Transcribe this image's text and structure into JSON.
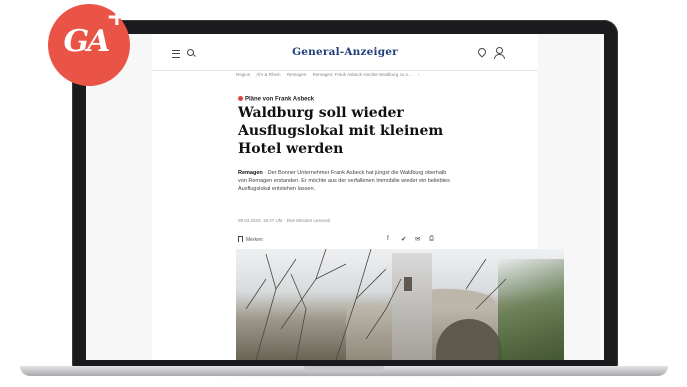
{
  "brand": {
    "logo_text": "GA",
    "logo_plus": "+",
    "site_name": "General-Anzeiger",
    "accent_color": "#ea5446",
    "site_color": "#1f3e78"
  },
  "breadcrumb": [
    "Region",
    "Ahr & Rhein",
    "Remagen",
    "Remagen: Frank Asbeck möchte Waldburg zu n...",
    "›"
  ],
  "article": {
    "kicker": "Pläne von Frank Asbeck",
    "headline": "Waldburg soll wieder Ausflugslokal mit kleinem Hotel werden",
    "lead_place": "Remagen",
    "lead_text": " · Der Bonner Unternehmer Frank Asbeck hat jüngst die Waldburg oberhalb von Remagen erstanden. Er möchte aus der verfallenen Immobilie wieder ein beliebtes Ausflugslokal entstehen lassen.",
    "meta": "09.03.2023, 18:47 Uhr · Drei Minuten Lesezeit",
    "bookmark_label": "Merken"
  },
  "share_icons": [
    "facebook-icon",
    "twitter-icon",
    "email-icon",
    "print-icon"
  ]
}
